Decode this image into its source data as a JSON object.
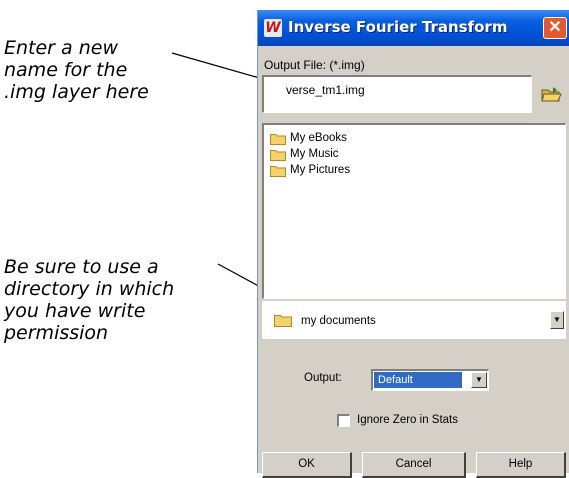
{
  "annotations": {
    "filename_note_lines": [
      "Enter a new",
      "name for the",
      ".img layer here"
    ],
    "directory_note_lines": [
      "Be sure to use a",
      "directory in which",
      "you have write",
      "permission"
    ]
  },
  "dialog": {
    "title": "Inverse Fourier Transform",
    "output_file_label": "Output File: (*.img)",
    "filename_value": "verse_tm1.img",
    "file_list": [
      "My eBooks",
      "My Music",
      "My Pictures"
    ],
    "directory": "my documents",
    "output_label": "Output:",
    "output_selected": "Default",
    "ignore_zero_label": "Ignore Zero in Stats",
    "ignore_zero_checked": false,
    "buttons": {
      "ok": "OK",
      "cancel": "Cancel",
      "help": "Help"
    }
  },
  "colors": {
    "titlebar": "#0050d8",
    "dialog_bg": "#d4d0c8",
    "close_button": "#e35a32",
    "folder": "#f2d36b",
    "selection": "#316ac5"
  },
  "icons": [
    "app-icon",
    "close-icon",
    "folder-open-icon",
    "folder-icon",
    "chevron-down-icon"
  ]
}
